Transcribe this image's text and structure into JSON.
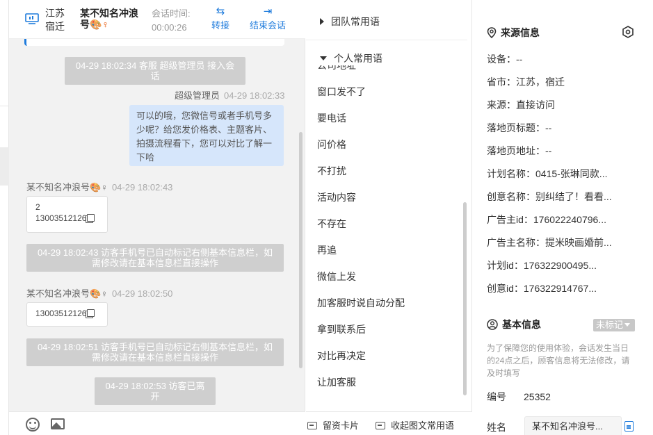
{
  "chat": {
    "header": {
      "location_line1": "江苏",
      "location_line2": "宿迁",
      "visitor_name": "某不知名冲浪号",
      "visitor_emoji": "🎨♀",
      "session_label": "会话时间:",
      "session_time": "00:00:26",
      "transfer_label": "转接",
      "end_label": "结束会话"
    },
    "messages": {
      "join_notice": "04-29 18:02:34 客服 超级管理员 接入会话",
      "agent_name": "超级管理员",
      "agent_time": "04-29 18:02:33",
      "agent_text": "可以的哦，您微信号或者手机号多少呢？给您发价格表、主题客片、拍摄流程看下，您可以对比了解一下哈",
      "visitor_name_1": "某不知名冲浪号🎨♀",
      "visitor_time_1": "04-29 18:02:43",
      "visitor_text_1a": "2",
      "visitor_text_1b": "13003512126",
      "sys_mark_1": "04-29 18:02:43 访客手机号已自动标记右侧基本信息栏，如需修改请在基本信息栏直接操作",
      "visitor_name_2": "某不知名冲浪号🎨♀",
      "visitor_time_2": "04-29 18:02:50",
      "visitor_text_2": "13003512126",
      "sys_mark_2": "04-29 18:02:51 访客手机号已自动标记右侧基本信息栏，如需修改请在基本信息栏直接操作",
      "left_notice": "04-29 18:02:53 访客已离开"
    }
  },
  "phrases": {
    "team_group": "团队常用语",
    "personal_group": "个人常用语",
    "clipped_item": "公司地址",
    "items": [
      "窗口发不了",
      "要电话",
      "问价格",
      "不打扰",
      "活动内容",
      "不存在",
      "再追",
      "微信上发",
      "加客服时说自动分配",
      "拿到联系后",
      "对比再决定",
      "让加客服"
    ],
    "footer": {
      "card_label": "留资卡片",
      "toggle_label": "收起图文常用语"
    }
  },
  "info": {
    "source_title": "来源信息",
    "source_rows": [
      "设备：--",
      "省市：江苏，宿迁",
      "来源：直接访问",
      "落地页标题：--",
      "落地页地址：--",
      "计划名称：0415-张琳同款...",
      "创意名称：别纠结了！看看...",
      "广告主id：176022240796...",
      "广告主名称：提米映画婚前...",
      "计划id：176322900495...",
      "创意id：176322914767..."
    ],
    "basic_title": "基本信息",
    "badge": "未标记",
    "note": "为了保障您的使用体验，会话发生当日的24点之后，顾客信息将无法修改，请及时填写",
    "id_label": "编号",
    "id_value": "25352",
    "name_label": "姓名",
    "name_value": "某不知名冲浪号..."
  },
  "colors": {
    "accent": "#1e7bdc",
    "agent_bubble": "#d6e6fb",
    "system_bubble": "#cfcfcf",
    "chat_bg": "#f2f2f2"
  }
}
